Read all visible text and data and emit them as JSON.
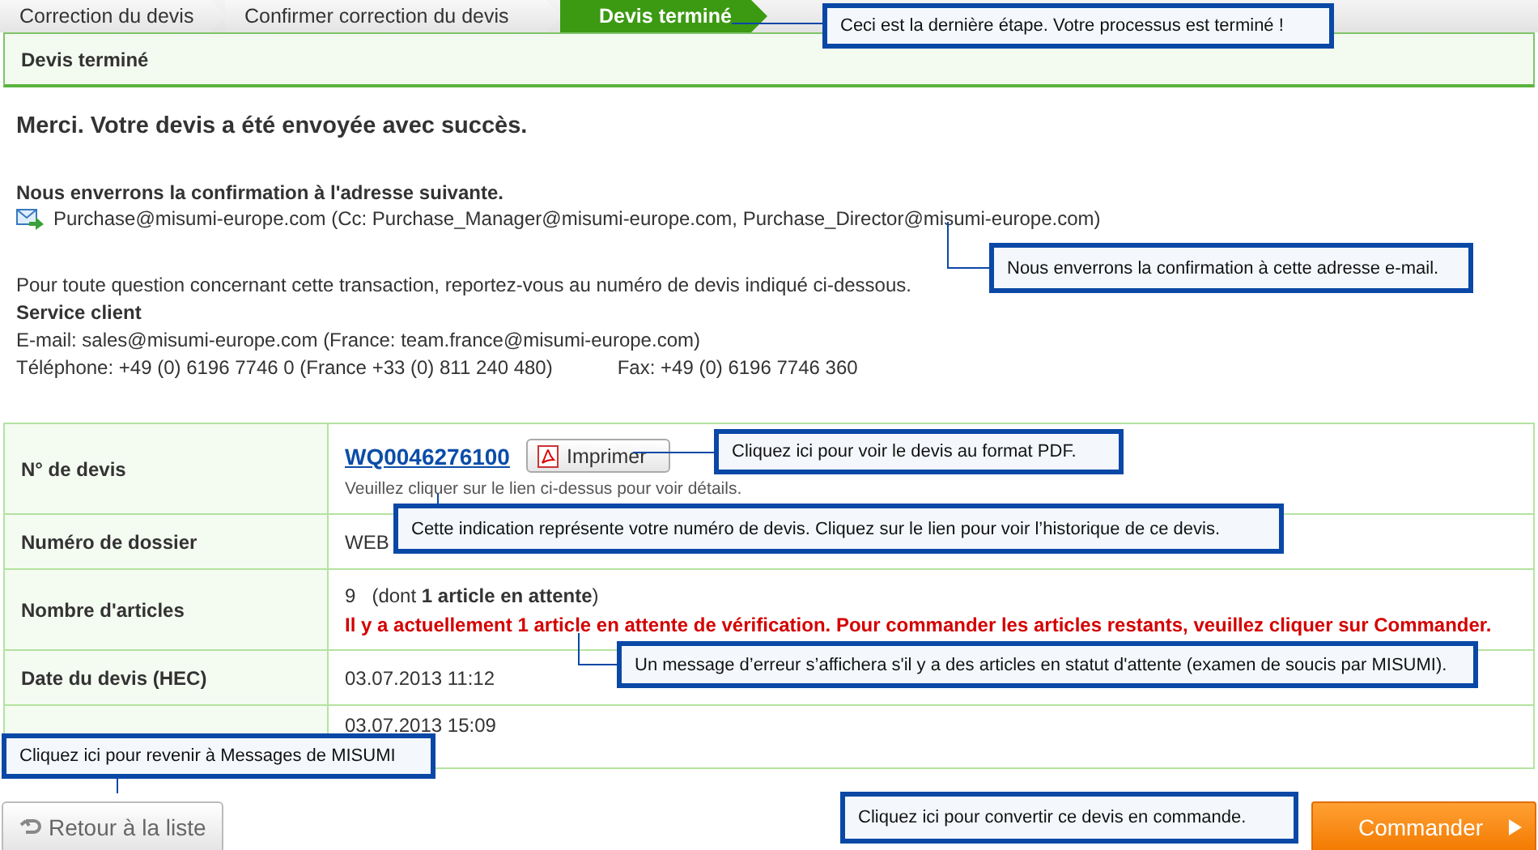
{
  "breadcrumb": [
    {
      "label": "Correction du devis",
      "selected": false
    },
    {
      "label": "Confirmer correction du devis",
      "selected": false
    },
    {
      "label": "Devis terminé",
      "selected": true
    }
  ],
  "page_title": "Devis terminé",
  "message": "Merci. Votre devis a été envoyée avec succès.",
  "confirmation": {
    "heading": "Nous enverrons la confirmation à l'adresse suivante.",
    "email": "Purchase@misumi-europe.com (Cc: Purchase_Manager@misumi-europe.com, Purchase_Director@misumi-europe.com)"
  },
  "contact": {
    "intro": "Pour toute question concernant cette transaction, reportez-vous au numéro de devis indiqué ci-dessous.",
    "heading": "Service client",
    "email_line": "E-mail: sales@misumi-europe.com (France: team.france@misumi-europe.com)",
    "phone": "Téléphone: +49 (0) 6196 7746 0 (France +33 (0) 811 240 480)",
    "fax": "Fax: +49 (0) 6196 7746 360"
  },
  "table": {
    "rows": [
      {
        "kind": "quote",
        "label": "N° de devis",
        "link": "WQ0046276100",
        "button": "Imprimer",
        "hint": "Veuillez cliquer sur le lien ci-dessus pour voir détails."
      },
      {
        "kind": "text",
        "label": "Numéro de dossier",
        "value": "WEB"
      },
      {
        "kind": "count",
        "label": "Nombre d'articles",
        "value": "9",
        "note": "(dont **1 article en attente**)",
        "warning": "Il y a actuellement 1 article en attente de vérification. Pour commander les articles restants, veuillez cliquer sur Commander."
      },
      {
        "kind": "text",
        "label": "Date du devis (HEC)",
        "value": "03.07.2013 11:12"
      },
      {
        "kind": "text",
        "value": "03.07.2013 15:09"
      }
    ]
  },
  "buttons": {
    "back": "Retour à la liste",
    "order": "Commander"
  },
  "annotations": [
    {
      "text": "Ceci est la dernière étape. Votre processus est terminé !"
    },
    {
      "text": "Nous enverrons la confirmation à cette adresse e-mail."
    },
    {
      "text": "Cliquez ici pour voir le devis au format PDF."
    },
    {
      "text": "Cette indication représente votre numéro de devis. Cliquez sur le lien pour voir l’historique de ce devis."
    },
    {
      "text": "Un message d’erreur s’affichera s'il y a des articles en statut d'attente (examen de soucis par MISUMI)."
    },
    {
      "text": "Cliquez ici pour revenir à Messages de MISUMI"
    },
    {
      "text": "Cliquez ici pour convertir ce devis en commande."
    }
  ]
}
